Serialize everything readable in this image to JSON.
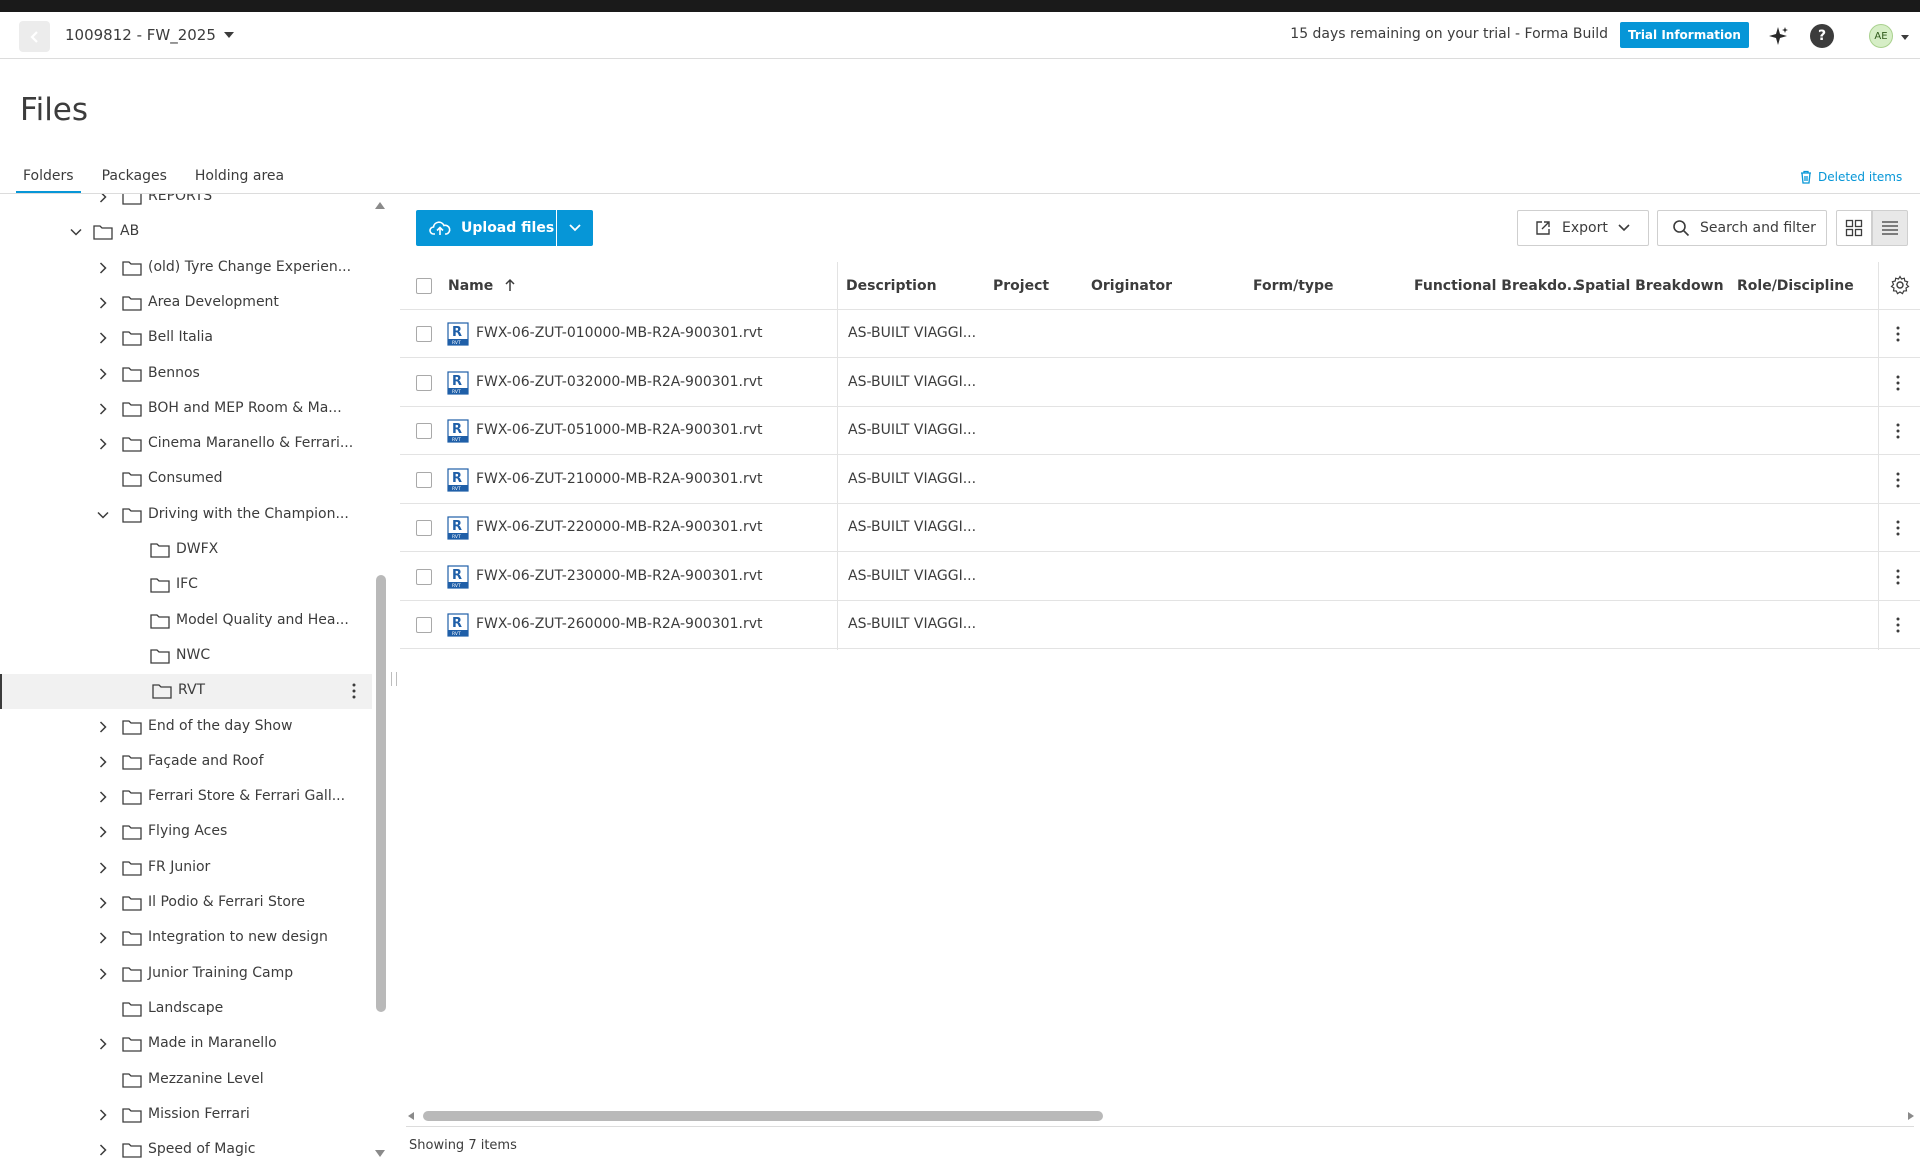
{
  "header": {
    "project_name": "1009812 - FW_2025",
    "trial_text": "15 days remaining on your trial - Forma Build",
    "trial_button": "Trial Information",
    "avatar_initials": "AE"
  },
  "page": {
    "title": "Files",
    "tabs": [
      "Folders",
      "Packages",
      "Holding area"
    ],
    "active_tab": "Folders",
    "deleted_items": "Deleted items"
  },
  "tree": {
    "rows": [
      {
        "label": "REPORTS",
        "level": 1,
        "chevron": "right"
      },
      {
        "label": "AB",
        "level": 0,
        "chevron": "down"
      },
      {
        "label": "(old) Tyre Change Experien...",
        "level": 1,
        "chevron": "right"
      },
      {
        "label": "Area Development",
        "level": 1,
        "chevron": "right"
      },
      {
        "label": "Bell Italia",
        "level": 1,
        "chevron": "right"
      },
      {
        "label": "Bennos",
        "level": 1,
        "chevron": "right"
      },
      {
        "label": "BOH and MEP Room & Ma...",
        "level": 1,
        "chevron": "right"
      },
      {
        "label": "Cinema Maranello & Ferrari...",
        "level": 1,
        "chevron": "right"
      },
      {
        "label": "Consumed",
        "level": 1,
        "chevron": "none"
      },
      {
        "label": "Driving with the Champion...",
        "level": 1,
        "chevron": "down"
      },
      {
        "label": "DWFX",
        "level": 2,
        "chevron": "none"
      },
      {
        "label": "IFC",
        "level": 2,
        "chevron": "none"
      },
      {
        "label": "Model Quality and Hea...",
        "level": 2,
        "chevron": "none"
      },
      {
        "label": "NWC",
        "level": 2,
        "chevron": "none"
      },
      {
        "label": "RVT",
        "level": 2,
        "chevron": "none",
        "selected": true
      },
      {
        "label": "End of the day Show",
        "level": 1,
        "chevron": "right"
      },
      {
        "label": "Façade and Roof",
        "level": 1,
        "chevron": "right"
      },
      {
        "label": "Ferrari Store & Ferrari Gall...",
        "level": 1,
        "chevron": "right"
      },
      {
        "label": "Flying Aces",
        "level": 1,
        "chevron": "right"
      },
      {
        "label": "FR Junior",
        "level": 1,
        "chevron": "right"
      },
      {
        "label": "Il Podio & Ferrari Store",
        "level": 1,
        "chevron": "right"
      },
      {
        "label": "Integration to new design",
        "level": 1,
        "chevron": "right"
      },
      {
        "label": "Junior Training Camp",
        "level": 1,
        "chevron": "right"
      },
      {
        "label": "Landscape",
        "level": 1,
        "chevron": "none"
      },
      {
        "label": "Made in Maranello",
        "level": 1,
        "chevron": "right"
      },
      {
        "label": "Mezzanine Level",
        "level": 1,
        "chevron": "none"
      },
      {
        "label": "Mission Ferrari",
        "level": 1,
        "chevron": "right"
      },
      {
        "label": "Speed of Magic",
        "level": 1,
        "chevron": "right"
      }
    ]
  },
  "toolbar": {
    "upload_label": "Upload files",
    "export_label": "Export",
    "search_label": "Search and filter"
  },
  "grid": {
    "columns": [
      "Name",
      "Description",
      "Project",
      "Originator",
      "Form/type",
      "Functional Breakdo...",
      "Spatial Breakdown",
      "Role/Discipline"
    ],
    "sort_column": "Name",
    "sort_direction": "ascending",
    "file_icon_text": "RVT",
    "rows": [
      {
        "name": "FWX-06-ZUT-010000-MB-R2A-900301.rvt",
        "description": "AS-BUILT VIAGGI..."
      },
      {
        "name": "FWX-06-ZUT-032000-MB-R2A-900301.rvt",
        "description": "AS-BUILT VIAGGI..."
      },
      {
        "name": "FWX-06-ZUT-051000-MB-R2A-900301.rvt",
        "description": "AS-BUILT VIAGGI..."
      },
      {
        "name": "FWX-06-ZUT-210000-MB-R2A-900301.rvt",
        "description": "AS-BUILT VIAGGI..."
      },
      {
        "name": "FWX-06-ZUT-220000-MB-R2A-900301.rvt",
        "description": "AS-BUILT VIAGGI..."
      },
      {
        "name": "FWX-06-ZUT-230000-MB-R2A-900301.rvt",
        "description": "AS-BUILT VIAGGI..."
      },
      {
        "name": "FWX-06-ZUT-260000-MB-R2A-900301.rvt",
        "description": "AS-BUILT VIAGGI..."
      }
    ]
  },
  "footer": {
    "showing": "Showing 7 items"
  },
  "colors": {
    "accent": "#0696d7",
    "text": "#3c3c3c",
    "selected_row": "#f1f1f1"
  }
}
